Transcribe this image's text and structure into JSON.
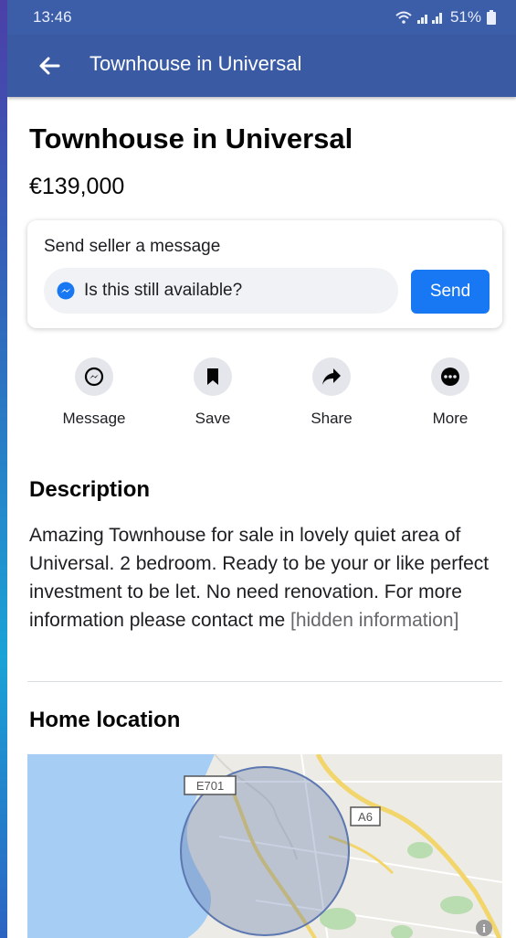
{
  "status_bar": {
    "time": "13:46",
    "battery": "51%"
  },
  "app_bar": {
    "title": "Townhouse in Universal"
  },
  "listing": {
    "title": "Townhouse in Universal",
    "price": "€139,000"
  },
  "message_card": {
    "label": "Send seller a message",
    "input_value": "Is this still available?",
    "send_label": "Send"
  },
  "actions": [
    {
      "label": "Message",
      "icon": "messenger-icon"
    },
    {
      "label": "Save",
      "icon": "bookmark-icon"
    },
    {
      "label": "Share",
      "icon": "share-arrow-icon"
    },
    {
      "label": "More",
      "icon": "more-dots-icon"
    }
  ],
  "description": {
    "heading": "Description",
    "text": "Amazing Townhouse for sale in lovely quiet area of Universal. 2 bedroom. Ready to be your or like perfect investment to be let. No need renovation. For more information please contact me",
    "hidden": "[hidden information]"
  },
  "location": {
    "heading": "Home location",
    "road_labels": [
      "E701",
      "A6"
    ]
  },
  "colors": {
    "app_bar": "#3a5ba4",
    "accent": "#1877f2",
    "water": "#a6cdf3"
  }
}
